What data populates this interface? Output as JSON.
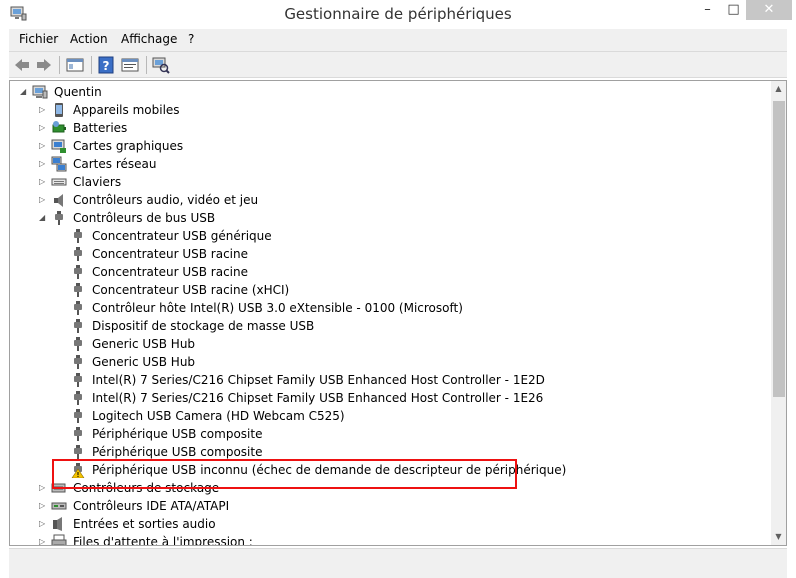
{
  "window": {
    "title": "Gestionnaire de périphériques",
    "min_glyph": "–",
    "max_glyph": "□",
    "close_glyph": "✕"
  },
  "menu": [
    "Fichier",
    "Action",
    "Affichage",
    "?"
  ],
  "tree": {
    "root": "Quentin",
    "items": [
      {
        "label": "Appareils mobiles",
        "level": 1,
        "state": "collapsed",
        "icon": "mobile-device-icon"
      },
      {
        "label": "Batteries",
        "level": 1,
        "state": "collapsed",
        "icon": "battery-icon"
      },
      {
        "label": "Cartes graphiques",
        "level": 1,
        "state": "collapsed",
        "icon": "display-adapter-icon"
      },
      {
        "label": "Cartes réseau",
        "level": 1,
        "state": "collapsed",
        "icon": "network-adapter-icon"
      },
      {
        "label": "Claviers",
        "level": 1,
        "state": "collapsed",
        "icon": "keyboard-icon"
      },
      {
        "label": "Contrôleurs audio, vidéo et jeu",
        "level": 1,
        "state": "collapsed",
        "icon": "speaker-icon"
      },
      {
        "label": "Contrôleurs de bus USB",
        "level": 1,
        "state": "expanded",
        "icon": "usb-icon"
      },
      {
        "label": "Concentrateur USB générique",
        "level": 2,
        "icon": "usb-icon"
      },
      {
        "label": "Concentrateur USB racine",
        "level": 2,
        "icon": "usb-icon"
      },
      {
        "label": "Concentrateur USB racine",
        "level": 2,
        "icon": "usb-icon"
      },
      {
        "label": "Concentrateur USB racine (xHCI)",
        "level": 2,
        "icon": "usb-icon"
      },
      {
        "label": "Contrôleur hôte Intel(R) USB 3.0 eXtensible - 0100 (Microsoft)",
        "level": 2,
        "icon": "usb-icon"
      },
      {
        "label": "Dispositif de stockage de masse USB",
        "level": 2,
        "icon": "usb-icon"
      },
      {
        "label": "Generic USB Hub",
        "level": 2,
        "icon": "usb-icon"
      },
      {
        "label": "Generic USB Hub",
        "level": 2,
        "icon": "usb-icon"
      },
      {
        "label": "Intel(R) 7 Series/C216 Chipset Family USB Enhanced Host Controller - 1E2D",
        "level": 2,
        "icon": "usb-icon"
      },
      {
        "label": "Intel(R) 7 Series/C216 Chipset Family USB Enhanced Host Controller - 1E26",
        "level": 2,
        "icon": "usb-icon"
      },
      {
        "label": "Logitech USB Camera (HD Webcam C525)",
        "level": 2,
        "icon": "usb-icon"
      },
      {
        "label": "Périphérique USB composite",
        "level": 2,
        "icon": "usb-icon"
      },
      {
        "label": "Périphérique USB composite",
        "level": 2,
        "icon": "usb-icon"
      },
      {
        "label": "Périphérique USB inconnu (échec de demande de descripteur de périphérique)",
        "level": 2,
        "icon": "usb-warning-icon"
      },
      {
        "label": "Contrôleurs de stockage",
        "level": 1,
        "state": "collapsed",
        "icon": "storage-controller-icon"
      },
      {
        "label": "Contrôleurs IDE ATA/ATAPI",
        "level": 1,
        "state": "collapsed",
        "icon": "ide-controller-icon"
      },
      {
        "label": "Entrées et sorties audio",
        "level": 1,
        "state": "collapsed",
        "icon": "audio-io-icon"
      },
      {
        "label": "Files d'attente à l'impression :",
        "level": 1,
        "state": "collapsed",
        "icon": "printer-icon"
      }
    ]
  },
  "colors": {
    "highlight_border": "#e11111",
    "warning": "#f5c400"
  }
}
